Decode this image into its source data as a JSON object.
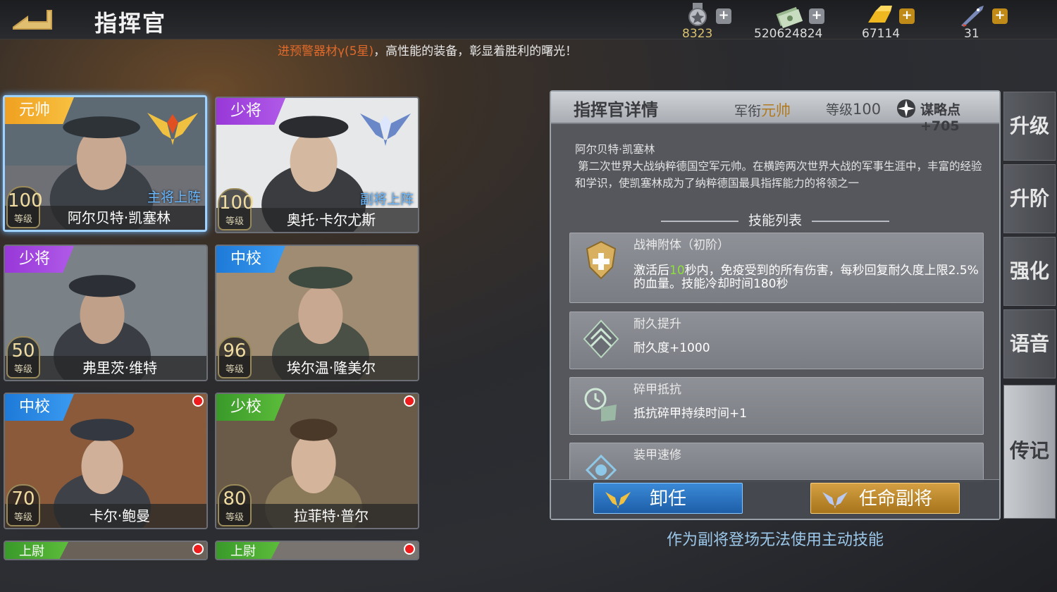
{
  "header": {
    "title": "指挥官"
  },
  "resources": [
    {
      "icon": "medal-icon",
      "value": "8323"
    },
    {
      "icon": "cash-icon",
      "value": "520624824"
    },
    {
      "icon": "gold-bar-icon",
      "value": "67114"
    },
    {
      "icon": "rocket-icon",
      "value": "31"
    }
  ],
  "ticker": {
    "highlight": "进预警器材γ(5星)",
    "text": "，高性能的装备，彰显着胜利的曙光！"
  },
  "commanders": [
    {
      "rank": "元帅",
      "name": "阿尔贝特·凯塞林",
      "level": "100",
      "level_label": "等级",
      "deploy": "主将上阵"
    },
    {
      "rank": "少将",
      "name": "奥托·卡尔尤斯",
      "level": "100",
      "level_label": "等级",
      "deploy": "副将上阵"
    },
    {
      "rank": "少将",
      "name": "弗里茨·维特",
      "level": "50",
      "level_label": "等级"
    },
    {
      "rank": "中校",
      "name": "埃尔温·隆美尔",
      "level": "96",
      "level_label": "等级"
    },
    {
      "rank": "中校",
      "name": "卡尔·鲍曼",
      "level": "70",
      "level_label": "等级"
    },
    {
      "rank": "少校",
      "name": "拉菲特·普尔",
      "level": "80",
      "level_label": "等级"
    },
    {
      "rank": "上尉"
    },
    {
      "rank": "上尉"
    }
  ],
  "detail": {
    "title": "指挥官详情",
    "rank_label": "军衔",
    "rank": "元帅",
    "level_label": "等级",
    "level": "100",
    "strategy": "谋略点+705",
    "name": "阿尔贝特·凯塞林",
    "bio": "第二次世界大战纳粹德国空军元帅。在横跨两次世界大战的军事生涯中，丰富的经验和学识，使凯塞林成为了纳粹德国最具指挥能力的将领之一",
    "skills_title": "技能列表",
    "skills": [
      {
        "name": "战神附体（初阶）",
        "desc_pre": "激活后",
        "desc_hl": "10",
        "desc_post": "秒内，免疫受到的所有伤害，每秒回复耐久度上限2.5%的血量。技能冷却时间180秒"
      },
      {
        "name": "耐久提升",
        "desc": "耐久度+1000"
      },
      {
        "name": "碎甲抵抗",
        "desc": "抵抗碎甲持续时间+1"
      },
      {
        "name": "装甲速修",
        "desc": ""
      }
    ],
    "btn_dismiss": "卸任",
    "btn_appoint": "任命副将",
    "note": "作为副将登场无法使用主动技能"
  },
  "tabs": [
    "升级",
    "升阶",
    "强化",
    "语音",
    "传记"
  ],
  "colors": {
    "rank_gold": "#f0a020",
    "rank_purple": "#9838d8",
    "rank_blue": "#1e7ad8",
    "rank_green": "#3a9a2a",
    "highlight_green": "#8ee03a"
  }
}
